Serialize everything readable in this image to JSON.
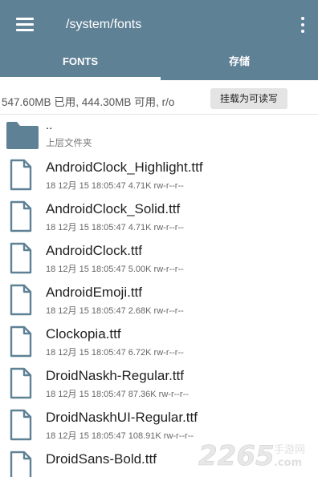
{
  "header": {
    "path_title": "/system/fonts",
    "menu_icon": "menu-icon",
    "more_icon": "more-vert-icon",
    "bar_color": "#5f8196"
  },
  "tabs": [
    {
      "label": "FONTS",
      "selected": true
    },
    {
      "label": "存储",
      "selected": false
    }
  ],
  "storage_info": {
    "text": "547.60MB 已用, 444.30MB 可用, r/o",
    "mount_button": "挂载为可读写"
  },
  "parent_folder": {
    "name": "..",
    "subtitle": "上层文件夹",
    "icon": "folder-icon",
    "icon_color": "#5f8196"
  },
  "files": [
    {
      "name": "AndroidClock_Highlight.ttf",
      "meta": "18 12月 15 18:05:47  4.71K  rw-r--r--"
    },
    {
      "name": "AndroidClock_Solid.ttf",
      "meta": "18 12月 15 18:05:47  4.71K  rw-r--r--"
    },
    {
      "name": "AndroidClock.ttf",
      "meta": "18 12月 15 18:05:47  5.00K  rw-r--r--"
    },
    {
      "name": "AndroidEmoji.ttf",
      "meta": "18 12月 15 18:05:47  2.68K  rw-r--r--"
    },
    {
      "name": "Clockopia.ttf",
      "meta": "18 12月 15 18:05:47  6.72K  rw-r--r--"
    },
    {
      "name": "DroidNaskh-Regular.ttf",
      "meta": "18 12月 15 18:05:47  87.36K  rw-r--r--"
    },
    {
      "name": "DroidNaskhUI-Regular.ttf",
      "meta": "18 12月 15 18:05:47  108.91K  rw-r--r--"
    },
    {
      "name": "DroidSans-Bold.ttf",
      "meta": ""
    }
  ],
  "watermark": {
    "number": "2265",
    "site": "手游网",
    "domain": ".com"
  }
}
